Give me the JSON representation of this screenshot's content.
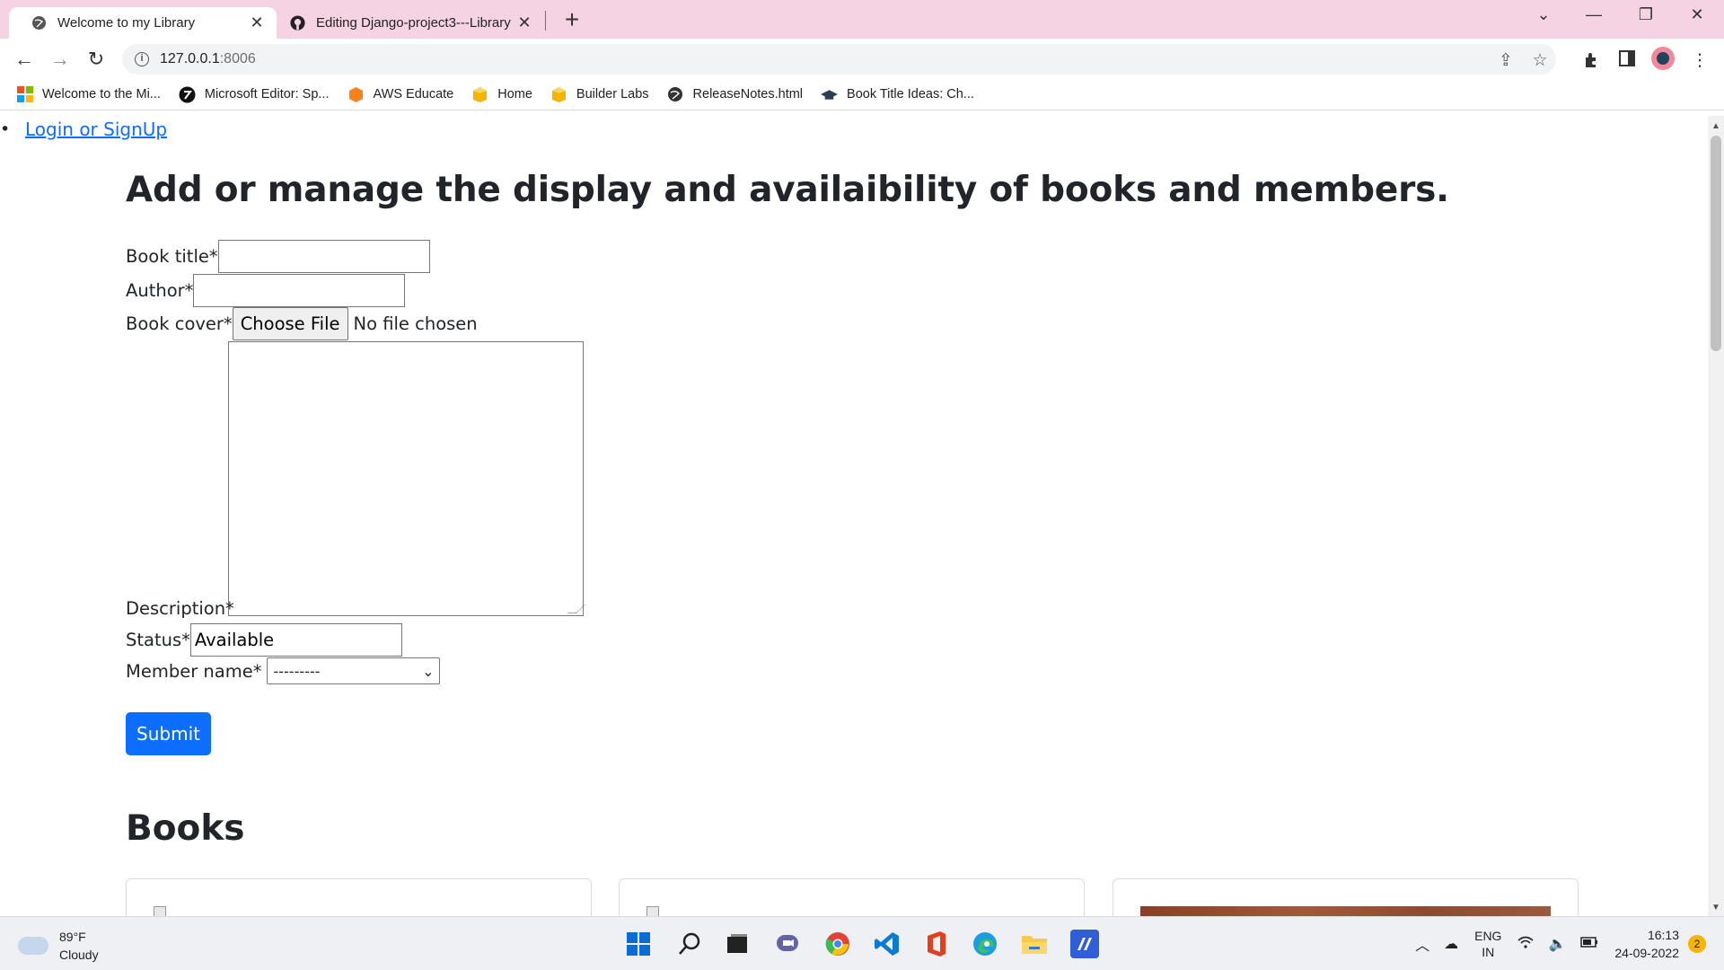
{
  "browser": {
    "tabs": [
      {
        "label": "Welcome to my Library",
        "active": true,
        "icon": "globe-icon"
      },
      {
        "label": "Editing Django-project3---Library",
        "active": false,
        "icon": "github-icon"
      }
    ],
    "new_tab_symbol": "+",
    "url_host": "127.0.0.1",
    "url_port": ":8006",
    "back_symbol": "←",
    "forward_symbol": "→",
    "reload_symbol": "↻",
    "info_symbol": "i",
    "bookmarks": [
      {
        "label": "Welcome to the Mi...",
        "icon": "microsoft-icon"
      },
      {
        "label": "Microsoft Editor: Sp...",
        "icon": "editor-icon"
      },
      {
        "label": "AWS Educate",
        "icon": "aws-icon"
      },
      {
        "label": "Home",
        "icon": "box-icon"
      },
      {
        "label": "Builder Labs",
        "icon": "box-icon"
      },
      {
        "label": "ReleaseNotes.html",
        "icon": "globe-icon"
      },
      {
        "label": "Book Title Ideas: Ch...",
        "icon": "graduation-cap-icon"
      }
    ]
  },
  "page": {
    "login_link": "Login or SignUp",
    "heading": "Add or manage the display and availaibility of books and members.",
    "form": {
      "book_title_label": "Book title*",
      "book_title_value": "",
      "author_label": "Author*",
      "author_value": "",
      "book_cover_label": "Book cover*",
      "choose_file_label": "Choose File",
      "no_file_text": "No file chosen",
      "description_label": "Description*",
      "description_value": "",
      "status_label": "Status*",
      "status_value": "Available",
      "member_label": "Member name*",
      "member_selected": "---------",
      "submit_label": "Submit"
    },
    "books_heading": "Books"
  },
  "taskbar": {
    "temperature": "89°F",
    "weather": "Cloudy",
    "lang_line1": "ENG",
    "lang_line2": "IN",
    "time": "16:13",
    "date": "24-09-2022",
    "notifications": "2"
  },
  "colors": {
    "tabbar_bg": "#f5d3e3",
    "link": "#0d6efd",
    "primary_button": "#0d6efd"
  }
}
